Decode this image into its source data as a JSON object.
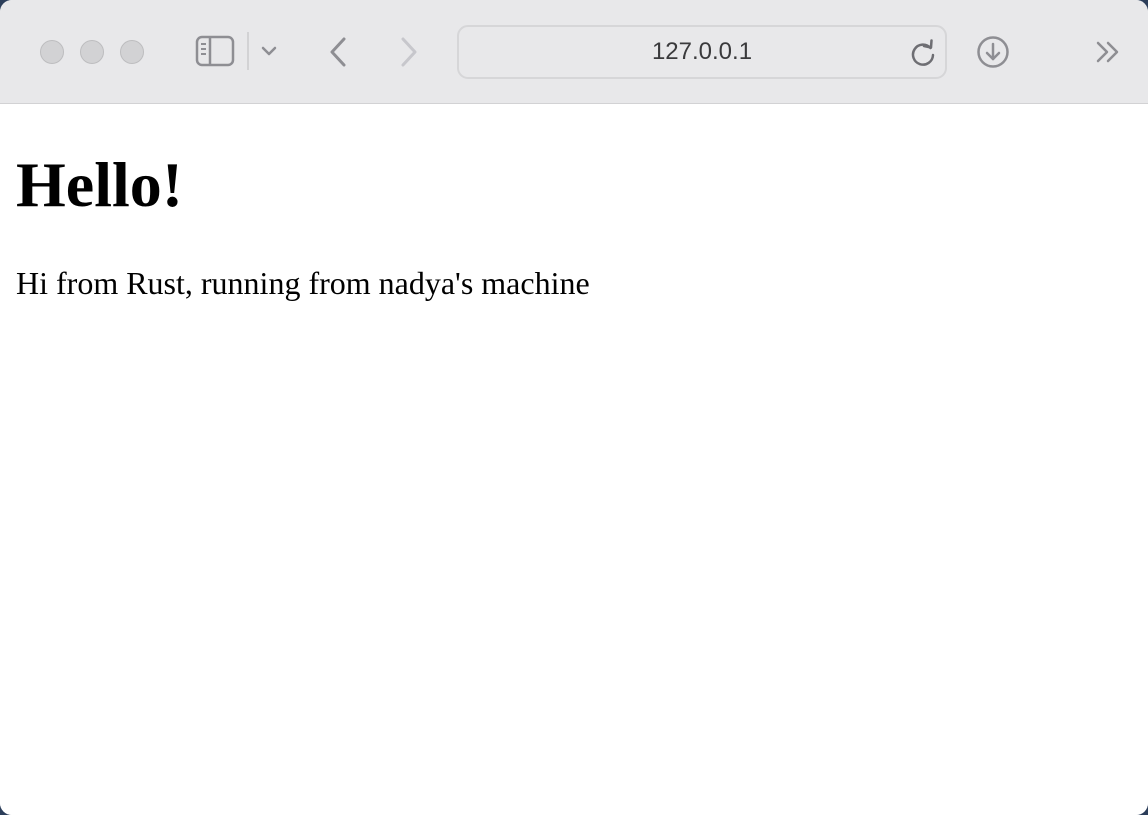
{
  "browser": {
    "address": "127.0.0.1",
    "icons": {
      "sidebar": "sidebar-icon",
      "sidebar_menu": "chevron-down-icon",
      "back": "chevron-left-icon",
      "forward": "chevron-right-icon",
      "reload": "reload-icon",
      "downloads": "download-icon",
      "more": "double-chevron-right-icon"
    },
    "colors": {
      "chrome": "#e8e8ea",
      "icon": "#8e8e93",
      "icon_disabled": "#c7c7cc"
    }
  },
  "page": {
    "heading": "Hello!",
    "paragraph": "Hi from Rust, running from nadya's machine"
  }
}
